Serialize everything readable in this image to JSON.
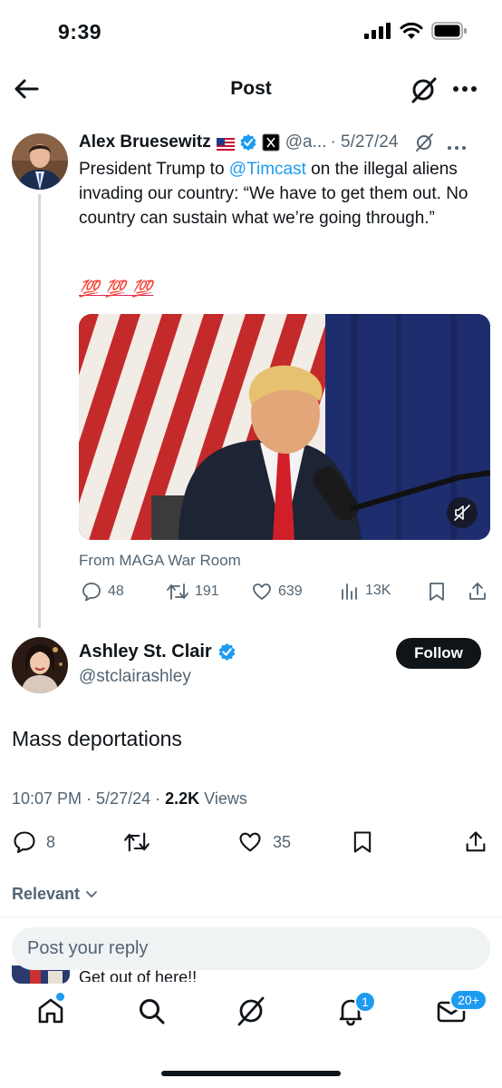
{
  "status_bar": {
    "time": "9:39"
  },
  "nav": {
    "title": "Post",
    "back_icon": "arrow-left-icon",
    "grok_icon": "grok-slash-icon",
    "more_icon": "more-horizontal-icon"
  },
  "parent_post": {
    "name": "Alex Bruesewitz",
    "handle": "@a...",
    "date": "· 5/27/24",
    "text_before": "President Trump to ",
    "mention": "@Timcast",
    "text_after": " on the illegal aliens invading our country: “We have to get them out. No country can sustain what we’re going through.”",
    "emoji": "💯 💯 💯",
    "media_source": "From MAGA War Room",
    "replies": "48",
    "reposts": "191",
    "likes": "639",
    "views": "13K"
  },
  "main_post": {
    "name": "Ashley St. Clair",
    "handle": "@stclairashley",
    "follow_label": "Follow",
    "text": "Mass deportations",
    "time": "10:07 PM",
    "date": "· 5/27/24 ·",
    "views_count": "2.2K",
    "views_label": "Views",
    "replies": "8",
    "likes": "35"
  },
  "sort": {
    "label": "Relevant"
  },
  "reply": {
    "placeholder": "Post your reply",
    "peek_text": "Get out of here!!"
  },
  "tabbar": {
    "notifications_badge": "1",
    "messages_badge": "20+"
  },
  "colors": {
    "accent": "#1d9bf0",
    "text": "#0f1419",
    "secondary": "#536471"
  }
}
